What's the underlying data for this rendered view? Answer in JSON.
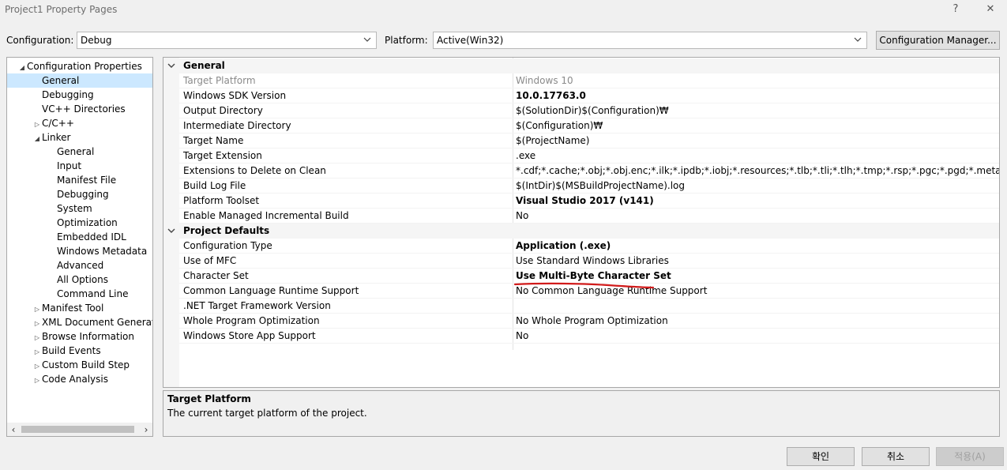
{
  "window": {
    "title": "Project1 Property Pages",
    "help": "?",
    "close": "✕"
  },
  "toolbar": {
    "config_label": "Configuration:",
    "config_value": "Debug",
    "platform_label": "Platform:",
    "platform_value": "Active(Win32)",
    "config_manager": "Configuration Manager..."
  },
  "tree": [
    {
      "label": "Configuration Properties",
      "expander": "◢",
      "level": 0
    },
    {
      "label": "General",
      "level": 1,
      "selected": true
    },
    {
      "label": "Debugging",
      "level": 1
    },
    {
      "label": "VC++ Directories",
      "level": 1
    },
    {
      "label": "C/C++",
      "expander": "▷",
      "level": 1
    },
    {
      "label": "Linker",
      "expander": "◢",
      "level": 1
    },
    {
      "label": "General",
      "level": 2
    },
    {
      "label": "Input",
      "level": 2
    },
    {
      "label": "Manifest File",
      "level": 2
    },
    {
      "label": "Debugging",
      "level": 2
    },
    {
      "label": "System",
      "level": 2
    },
    {
      "label": "Optimization",
      "level": 2
    },
    {
      "label": "Embedded IDL",
      "level": 2
    },
    {
      "label": "Windows Metadata",
      "level": 2
    },
    {
      "label": "Advanced",
      "level": 2
    },
    {
      "label": "All Options",
      "level": 2
    },
    {
      "label": "Command Line",
      "level": 2
    },
    {
      "label": "Manifest Tool",
      "expander": "▷",
      "level": 1
    },
    {
      "label": "XML Document Generator",
      "expander": "▷",
      "level": 1
    },
    {
      "label": "Browse Information",
      "expander": "▷",
      "level": 1
    },
    {
      "label": "Build Events",
      "expander": "▷",
      "level": 1
    },
    {
      "label": "Custom Build Step",
      "expander": "▷",
      "level": 1
    },
    {
      "label": "Code Analysis",
      "expander": "▷",
      "level": 1
    }
  ],
  "grid": [
    {
      "type": "cat",
      "name": "General"
    },
    {
      "name": "Target Platform",
      "value": "Windows 10",
      "dim": true
    },
    {
      "name": "Windows SDK Version",
      "value": "10.0.17763.0",
      "bold": true
    },
    {
      "name": "Output Directory",
      "value": "$(SolutionDir)$(Configuration)₩"
    },
    {
      "name": "Intermediate Directory",
      "value": "$(Configuration)₩"
    },
    {
      "name": "Target Name",
      "value": "$(ProjectName)"
    },
    {
      "name": "Target Extension",
      "value": ".exe"
    },
    {
      "name": "Extensions to Delete on Clean",
      "value": "*.cdf;*.cache;*.obj;*.obj.enc;*.ilk;*.ipdb;*.iobj;*.resources;*.tlb;*.tli;*.tlh;*.tmp;*.rsp;*.pgc;*.pgd;*.meta;*.tlog;*.manifest"
    },
    {
      "name": "Build Log File",
      "value": "$(IntDir)$(MSBuildProjectName).log"
    },
    {
      "name": "Platform Toolset",
      "value": "Visual Studio 2017 (v141)",
      "bold": true
    },
    {
      "name": "Enable Managed Incremental Build",
      "value": "No"
    },
    {
      "type": "cat",
      "name": "Project Defaults"
    },
    {
      "name": "Configuration Type",
      "value": "Application (.exe)",
      "bold": true
    },
    {
      "name": "Use of MFC",
      "value": "Use Standard Windows Libraries"
    },
    {
      "name": "Character Set",
      "value": "Use Multi-Byte Character Set",
      "bold": true
    },
    {
      "name": "Common Language Runtime Support",
      "value": "No Common Language Runtime Support"
    },
    {
      "name": ".NET Target Framework Version",
      "value": ""
    },
    {
      "name": "Whole Program Optimization",
      "value": "No Whole Program Optimization"
    },
    {
      "name": "Windows Store App Support",
      "value": "No"
    }
  ],
  "description": {
    "title": "Target Platform",
    "text": "The current target platform of the project."
  },
  "buttons": {
    "ok": "확인",
    "cancel": "취소",
    "apply": "적용(A)"
  },
  "colors": {
    "selection": "#cce8ff",
    "annotation": "#d11b1b"
  }
}
